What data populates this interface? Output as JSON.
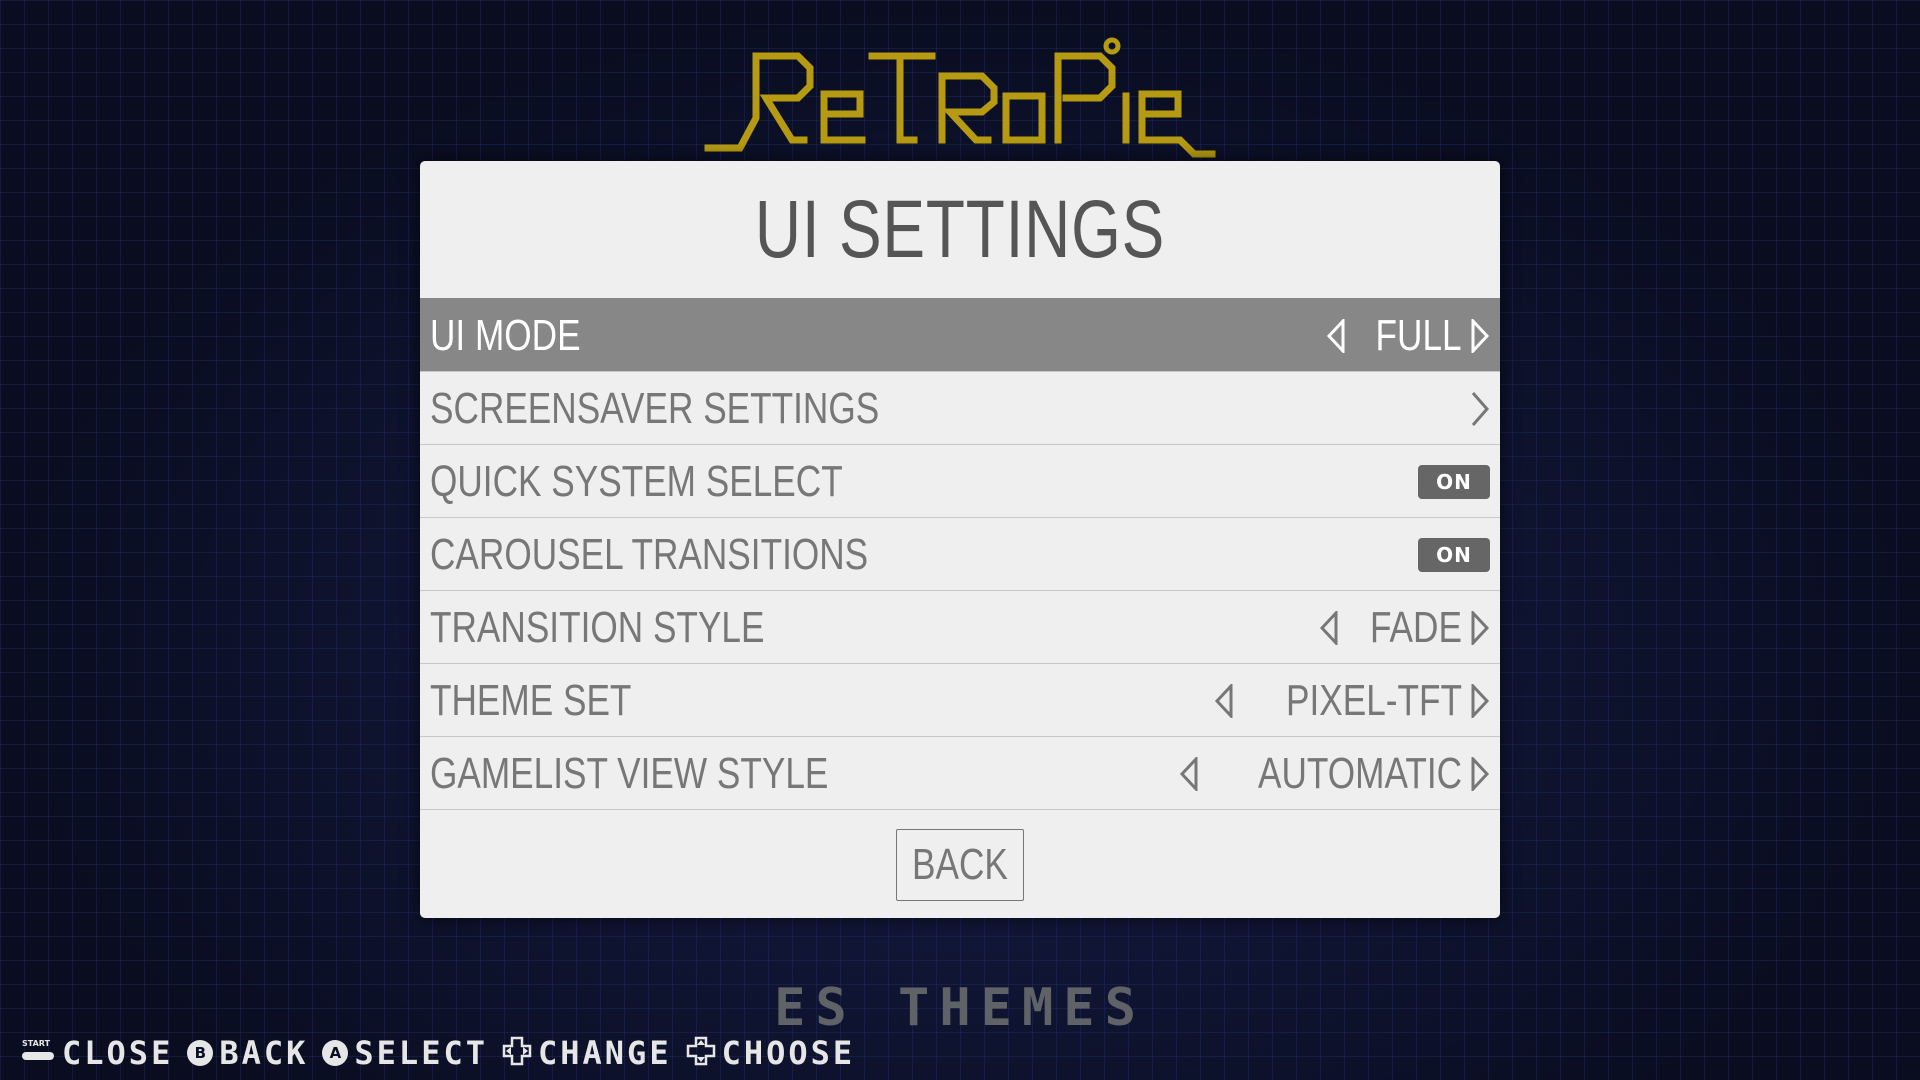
{
  "logo": {
    "text": "RetroPie",
    "color": "#b59a12"
  },
  "dialog": {
    "title": "UI SETTINGS",
    "rows": [
      {
        "label": "UI MODE",
        "value": "FULL",
        "control": "selector",
        "selected": true
      },
      {
        "label": "SCREENSAVER SETTINGS",
        "value": "",
        "control": "submenu",
        "selected": false
      },
      {
        "label": "QUICK SYSTEM SELECT",
        "value": "ON",
        "control": "toggle",
        "selected": false
      },
      {
        "label": "CAROUSEL TRANSITIONS",
        "value": "ON",
        "control": "toggle",
        "selected": false
      },
      {
        "label": "TRANSITION STYLE",
        "value": "FADE",
        "control": "selector",
        "selected": false
      },
      {
        "label": "THEME SET",
        "value": "PIXEL-TFT",
        "control": "selector",
        "selected": false
      },
      {
        "label": "GAMELIST VIEW STYLE",
        "value": "AUTOMATIC",
        "control": "selector",
        "selected": false
      }
    ],
    "back_label": "BACK"
  },
  "footer": {
    "system_name": "ES THEMES"
  },
  "help": [
    {
      "icon": "start-button-icon",
      "label": "CLOSE"
    },
    {
      "icon": "b-button-icon",
      "glyph": "B",
      "label": "BACK"
    },
    {
      "icon": "a-button-icon",
      "glyph": "A",
      "label": "SELECT"
    },
    {
      "icon": "dpad-horizontal-icon",
      "label": "CHANGE"
    },
    {
      "icon": "dpad-vertical-icon",
      "label": "CHOOSE"
    }
  ],
  "help_start_text": "START",
  "colors": {
    "panel_bg": "#efefef",
    "selected_row": "#878787",
    "text": "#777777",
    "toggle_bg": "#666666",
    "background": "#0b0f24"
  }
}
